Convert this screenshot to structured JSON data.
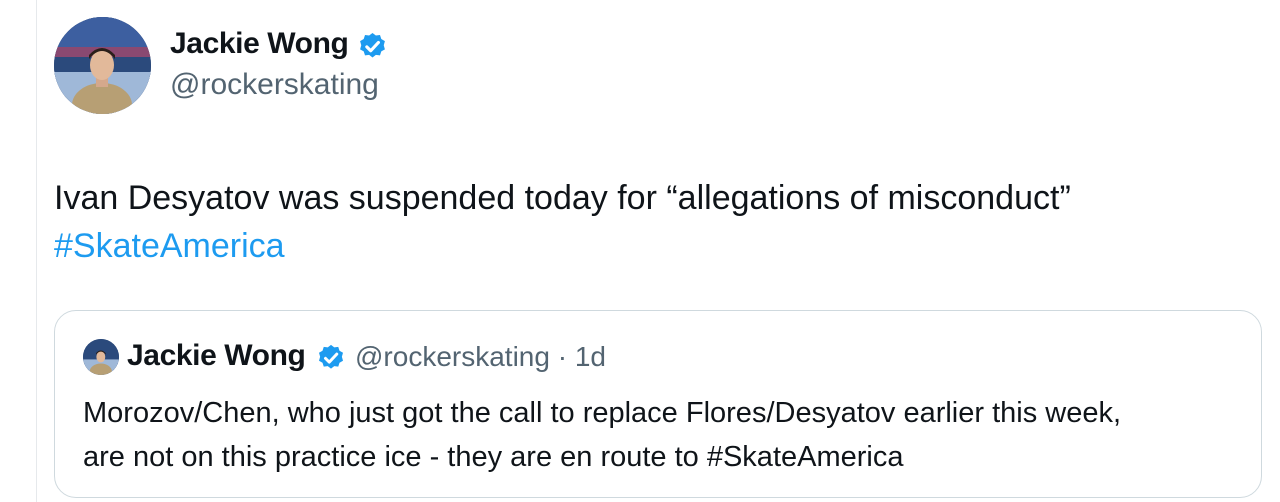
{
  "tweet": {
    "author": {
      "name": "Jackie Wong",
      "handle": "@rockerskating",
      "verified": true
    },
    "text": "Ivan Desyatov was suspended today for “allegations of misconduct”",
    "hashtag": "#SkateAmerica"
  },
  "quoted_tweet": {
    "author": {
      "name": "Jackie Wong",
      "handle_time": "@rockerskating · 1d",
      "verified": true
    },
    "text_lines": [
      "Morozov/Chen, who just got the call to replace Flores/Desyatov earlier this week,",
      "are not on this practice ice - they are en route to #SkateAmerica"
    ]
  },
  "colors": {
    "text": "#0f1419",
    "secondary": "#536471",
    "link": "#1d9bf0",
    "verified_badge": "#1d9bf0",
    "border": "#cfd9de"
  },
  "icons": {
    "verified": "verified-badge-icon"
  }
}
